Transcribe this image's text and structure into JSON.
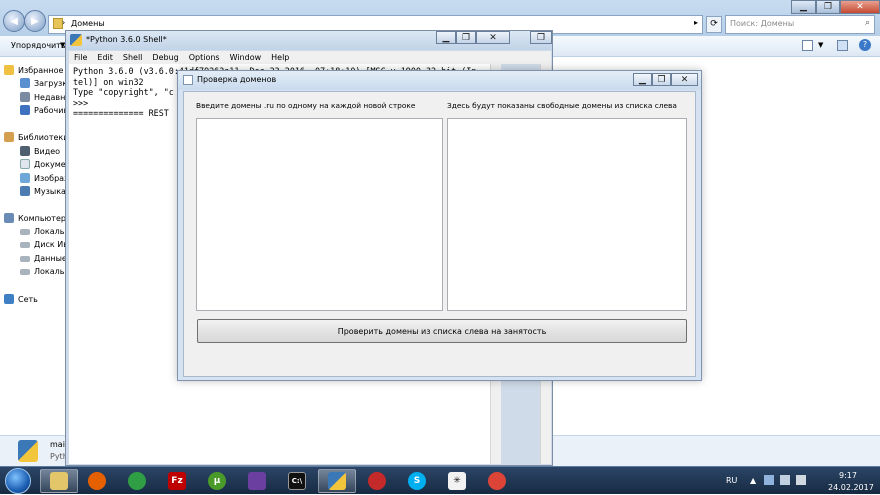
{
  "explorer": {
    "address": "Домены",
    "search_placeholder": "Поиск: Домены",
    "organize": "Упорядочить",
    "nav": {
      "favorites": "Избранное",
      "downloads": "Загрузки",
      "recent": "Недавни",
      "desktop": "Рабочий",
      "libraries": "Библиотеки",
      "videos": "Видео",
      "documents": "Докумен",
      "images": "Изображ",
      "music": "Музыка",
      "computer": "Компьютер",
      "local1": "Локальн",
      "disk": "Диск Ива",
      "data": "Данные (",
      "local2": "Локальн",
      "network": "Сеть"
    },
    "bottom_file_name": "mai",
    "bottom_file_type": "Pyth"
  },
  "shell": {
    "title": "*Python 3.6.0 Shell*",
    "menu": [
      "File",
      "Edit",
      "Shell",
      "Debug",
      "Options",
      "Window",
      "Help"
    ],
    "lines": [
      "Python 3.6.0 (v3.6.0:41df79263a11, Dec 23 2016, 07:18:10) [MSC v.1900 32 bit (In",
      "tel)] on win32",
      "Type \"copyright\", \"c",
      ">>>",
      "============== REST"
    ]
  },
  "dialog": {
    "title": "Проверка доменов",
    "left_label": "Введите домены .ru по одному на каждой новой строке",
    "right_label": "Здесь будут показаны свободные домены из списка слева",
    "left_value": "",
    "right_value": "",
    "button": "Проверить домены из списка слева на занятость"
  },
  "taskbar": {
    "lang": "RU",
    "time": "9:17",
    "date": "24.02.2017"
  },
  "colors": {
    "firefox": "#e66000",
    "filezilla": "#bf0000",
    "utorrent": "#4a9a2a",
    "skype": "#00aff0",
    "chrome": "#db4437"
  }
}
